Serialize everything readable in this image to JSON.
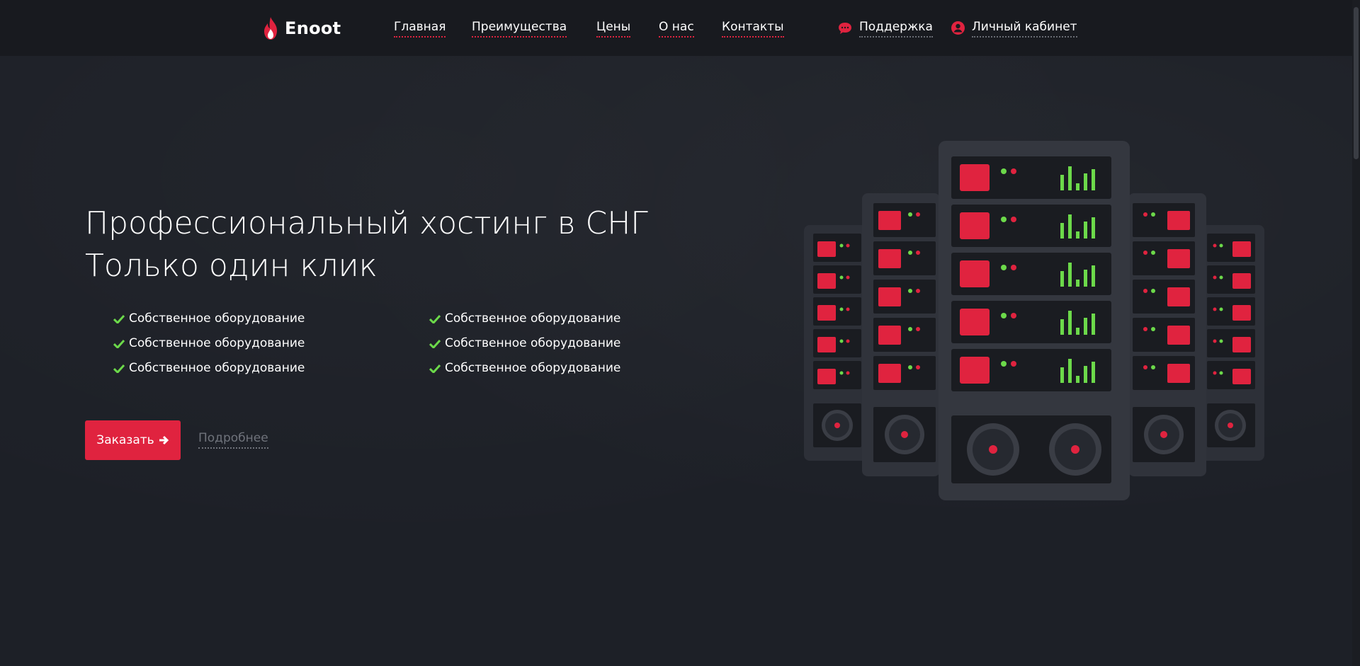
{
  "header": {
    "logo_text": "Enoot",
    "nav": [
      "Главная",
      "Преимущества",
      "Цены",
      "О нас",
      "Контакты"
    ],
    "support_label": "Поддержка",
    "account_label": "Личный кабинет"
  },
  "hero": {
    "title_line1": "Профессиональный хостинг в СНГ",
    "title_line2": "Только один клик",
    "features": [
      "Собственное оборудование",
      "Собственное оборудование",
      "Собственное оборудование",
      "Собственное оборудование",
      "Собственное оборудование",
      "Собственное оборудование"
    ],
    "order_label": "Заказать",
    "more_label": "Подробнее"
  },
  "icons": {
    "logo": "flame-icon",
    "support": "chat-bubble-icon",
    "account": "user-circle-icon",
    "feature": "check-icon",
    "order": "arrow-right-icon"
  },
  "colors": {
    "accent": "#e0233f",
    "background": "#1e2128",
    "header": "#181a1f",
    "check": "#6cd94a"
  }
}
